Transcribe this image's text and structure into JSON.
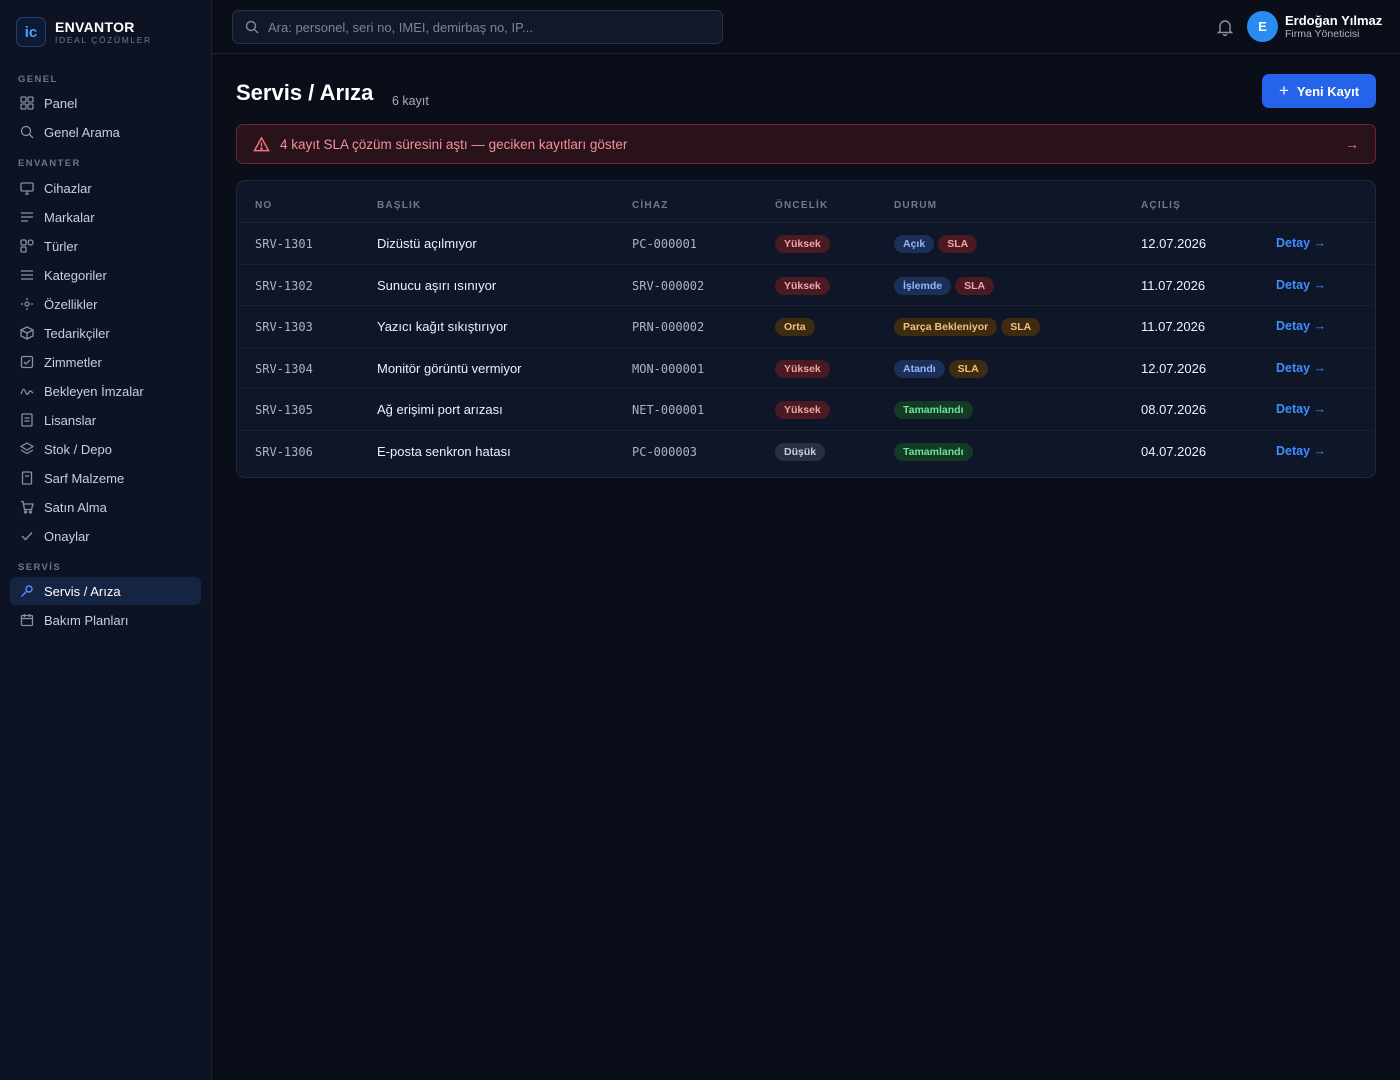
{
  "brand": {
    "logo_text": "ic",
    "name": "ENVANTOR",
    "subtitle": "İDEAL ÇÖZÜMLER"
  },
  "sidebar": {
    "sections": [
      {
        "label": "GENEL"
      },
      {
        "label": "ENVANTER"
      },
      {
        "label": "SERVİS"
      }
    ],
    "items": [
      {
        "label": "Panel",
        "icon": "grid-icon"
      },
      {
        "label": "Genel Arama",
        "icon": "search-icon"
      },
      {
        "label": "Cihazlar",
        "icon": "monitor-icon"
      },
      {
        "label": "Markalar",
        "icon": "tag-lines-icon"
      },
      {
        "label": "Türler",
        "icon": "shapes-icon"
      },
      {
        "label": "Kategoriler",
        "icon": "list-icon"
      },
      {
        "label": "Özellikler",
        "icon": "sliders-icon"
      },
      {
        "label": "Tedarikçiler",
        "icon": "box-icon"
      },
      {
        "label": "Zimmetler",
        "icon": "checkbox-icon"
      },
      {
        "label": "Bekleyen İmzalar",
        "icon": "signature-icon"
      },
      {
        "label": "Lisanslar",
        "icon": "document-icon"
      },
      {
        "label": "Stok / Depo",
        "icon": "layers-icon"
      },
      {
        "label": "Sarf Malzeme",
        "icon": "file-icon"
      },
      {
        "label": "Satın Alma",
        "icon": "cart-icon"
      },
      {
        "label": "Onaylar",
        "icon": "check-icon"
      },
      {
        "label": "Servis / Arıza",
        "icon": "wrench-icon",
        "active": true
      },
      {
        "label": "Bakım Planları",
        "icon": "calendar-icon"
      }
    ]
  },
  "topbar": {
    "search_placeholder": "Ara: personel, seri no, IMEI, demirbaş no, IP...",
    "user_initial": "E",
    "user_name": "Erdoğan Yılmaz",
    "user_role": "Firma Yöneticisi"
  },
  "page": {
    "title": "Servis / Arıza",
    "count": "6 kayıt",
    "new_button": "Yeni Kayıt",
    "alert": "4 kayıt SLA çözüm süresini aştı — geciken kayıtları göster",
    "alert_arrow": "→"
  },
  "table": {
    "columns": [
      "NO",
      "BAŞLIK",
      "CİHAZ",
      "ÖNCELİK",
      "DURUM",
      "AÇILIŞ"
    ],
    "detail_label": "Detay →",
    "rows": [
      {
        "no": "SRV-1301",
        "title": "Dizüstü açılmıyor",
        "device": "PC-000001",
        "priority": "Yüksek",
        "priority_color": "red",
        "status": "Açık",
        "status_color": "blue",
        "sla": "SLA",
        "opened": "12.07.2026"
      },
      {
        "no": "SRV-1302",
        "title": "Sunucu aşırı ısınıyor",
        "device": "SRV-000002",
        "priority": "Yüksek",
        "priority_color": "red",
        "status": "İşlemde",
        "status_color": "blue",
        "sla": "SLA",
        "opened": "11.07.2026"
      },
      {
        "no": "SRV-1303",
        "title": "Yazıcı kağıt sıkıştırıyor",
        "device": "PRN-000002",
        "priority": "Orta",
        "priority_color": "orange",
        "status": "Parça Bekleniyor",
        "status_color": "orange",
        "sla": "SLA",
        "opened": "11.07.2026"
      },
      {
        "no": "SRV-1304",
        "title": "Monitör görüntü vermiyor",
        "device": "MON-000001",
        "priority": "Yüksek",
        "priority_color": "red",
        "status": "Atandı",
        "status_color": "blue",
        "sla": "SLA",
        "opened": "12.07.2026"
      },
      {
        "no": "SRV-1305",
        "title": "Ağ erişimi port arızası",
        "device": "NET-000001",
        "priority": "Yüksek",
        "priority_color": "red",
        "status": "Tamamlandı",
        "status_color": "green",
        "sla": "",
        "opened": "08.07.2026"
      },
      {
        "no": "SRV-1306",
        "title": "E-posta senkron hatası",
        "device": "PC-000003",
        "priority": "Düşük",
        "priority_color": "gray",
        "status": "Tamamlandı",
        "status_color": "green",
        "sla": "",
        "opened": "04.07.2026"
      }
    ]
  },
  "colors": {
    "accent": "#2563eb",
    "link": "#3f8cff",
    "background": "#0a0e19",
    "sidebar": "#0d1322"
  }
}
